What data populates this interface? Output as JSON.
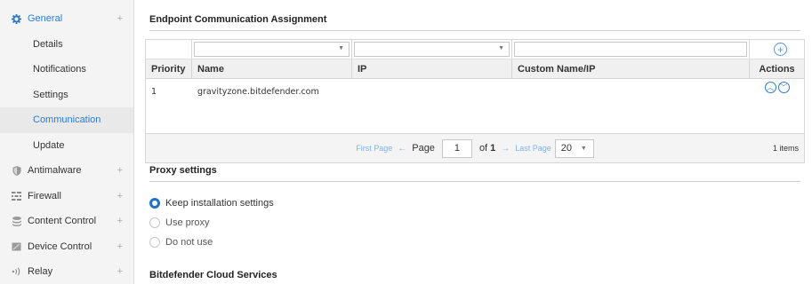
{
  "sidebar": {
    "general": {
      "label": "General",
      "expander": "+"
    },
    "general_items": [
      "Details",
      "Notifications",
      "Settings",
      "Communication",
      "Update"
    ],
    "other": [
      {
        "label": "Antimalware",
        "expander": "+"
      },
      {
        "label": "Firewall",
        "expander": "+"
      },
      {
        "label": "Content Control",
        "expander": "+"
      },
      {
        "label": "Device Control",
        "expander": "+"
      },
      {
        "label": "Relay",
        "expander": "+"
      }
    ]
  },
  "endpoint": {
    "title": "Endpoint Communication Assignment",
    "columns": [
      "Priority",
      "Name",
      "IP",
      "Custom Name/IP",
      "Actions"
    ],
    "rows": [
      {
        "priority": "1",
        "name": "gravityzone.bitdefender.com",
        "ip": "",
        "custom": ""
      }
    ],
    "add_symbol": "+"
  },
  "pager": {
    "first": "First Page",
    "prev_arrow": "←",
    "page_label": "Page",
    "page_value": "1",
    "of_label": "of",
    "total_pages": "1",
    "next_arrow": "→",
    "last": "Last Page",
    "per_page": "20",
    "items": "1 items"
  },
  "proxy": {
    "title": "Proxy settings",
    "options": [
      {
        "label": "Keep installation settings",
        "selected": true
      },
      {
        "label": "Use proxy",
        "selected": false
      },
      {
        "label": "Do not use",
        "selected": false
      }
    ]
  },
  "cloud": {
    "title": "Bitdefender Cloud Services"
  },
  "colors": {
    "accent": "#2f7ac8",
    "radio_on": "#1f73c8",
    "sidebar_bg": "#f4f4f4"
  }
}
